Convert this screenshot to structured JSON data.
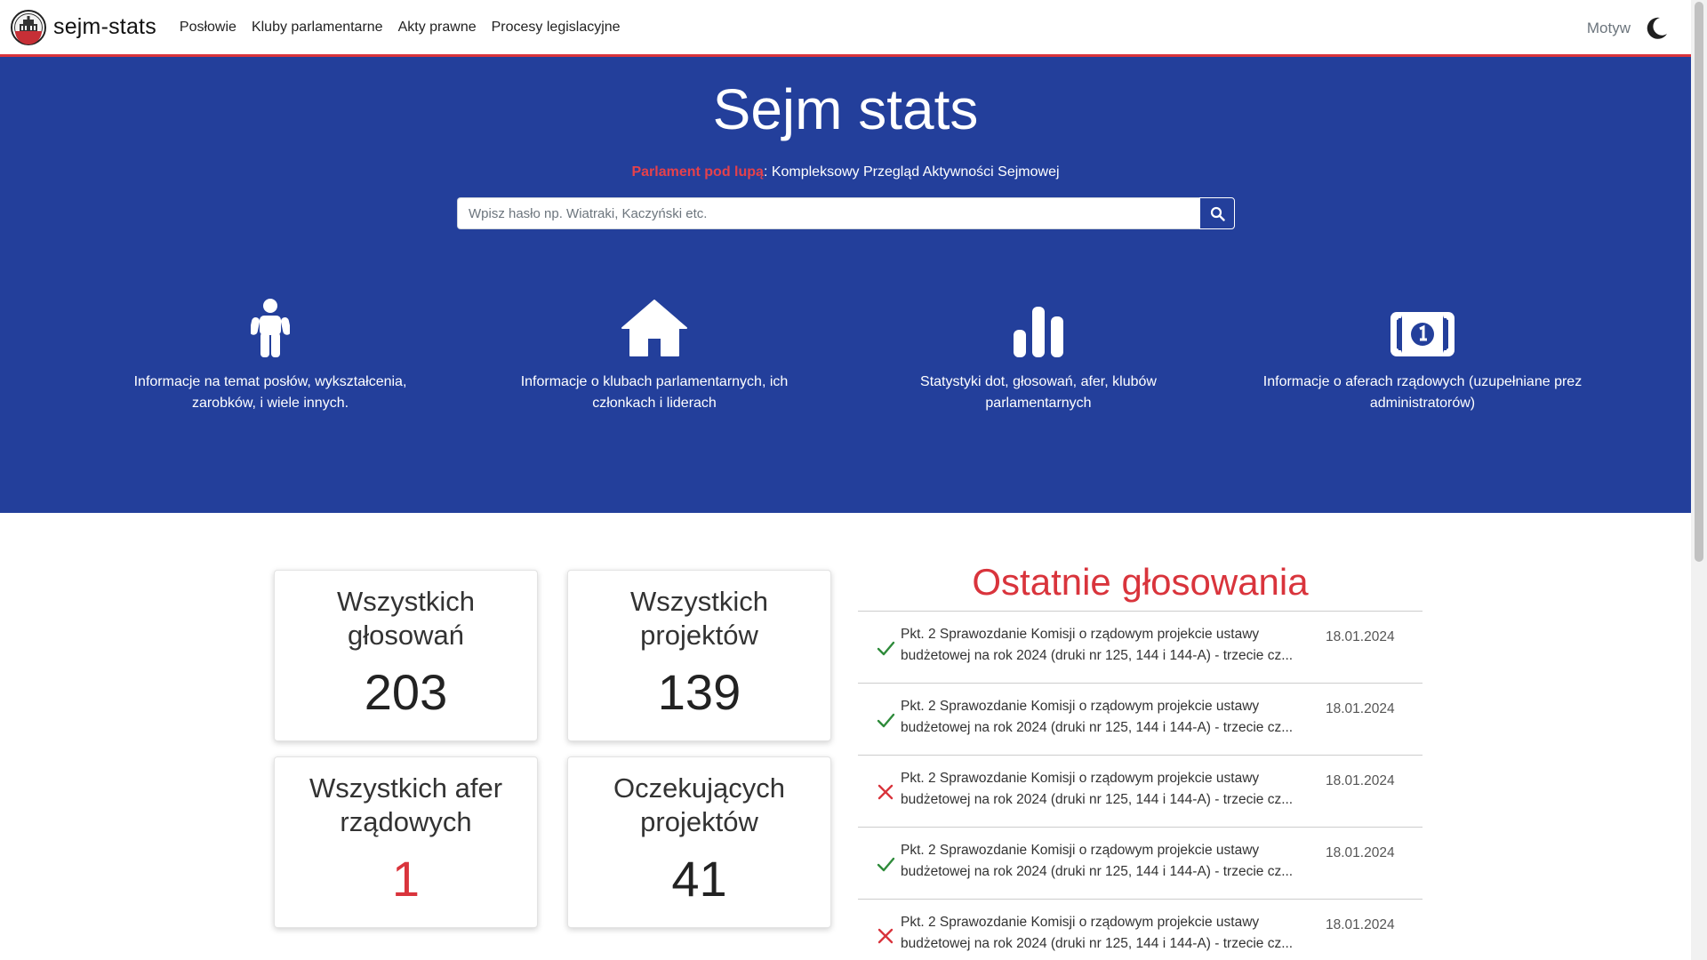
{
  "navbar": {
    "brand": "sejm-stats",
    "links": [
      "Posłowie",
      "Kluby parlamentarne",
      "Akty prawne",
      "Procesy legislacyjne"
    ],
    "theme_label": "Motyw"
  },
  "hero": {
    "title": "Sejm stats",
    "subtitle_highlight": "Parlament pod lupą",
    "subtitle_rest": ": Kompleksowy Przegląd Aktywności Sejmowej",
    "search_placeholder": "Wpisz hasło np. Wiatraki, Kaczyński etc."
  },
  "features": [
    {
      "icon": "person-icon",
      "text": "Informacje na temat posłów, wykształcenia, zarobków, i wiele innych."
    },
    {
      "icon": "house-icon",
      "text": "Informacje o klubach parlamentarnych, ich członkach i liderach"
    },
    {
      "icon": "bar-chart-icon",
      "text": "Statystyki dot, głosowań, afer, klubów parlamentarnych"
    },
    {
      "icon": "money-bill-icon",
      "text": "Informacje o aferach rządowych (uzupełniane prez administratorów)"
    }
  ],
  "stats": [
    {
      "label": "Wszystkich głosowań",
      "value": "203"
    },
    {
      "label": "Wszystkich projektów",
      "value": "139"
    },
    {
      "label": "Wszystkich afer rządowych",
      "value": "1"
    },
    {
      "label": "Oczekujących projektów",
      "value": "41"
    }
  ],
  "votes": {
    "title": "Ostatnie głosowania",
    "items": [
      {
        "status": "passed",
        "text": "Pkt. 2 Sprawozdanie Komisji o rządowym projekcie ustawy budżetowej na rok 2024 (druki nr 125, 144 i 144-A) - trzecie cz...",
        "date": "18.01.2024"
      },
      {
        "status": "passed",
        "text": "Pkt. 2 Sprawozdanie Komisji o rządowym projekcie ustawy budżetowej na rok 2024 (druki nr 125, 144 i 144-A) - trzecie cz...",
        "date": "18.01.2024"
      },
      {
        "status": "rejected",
        "text": "Pkt. 2 Sprawozdanie Komisji o rządowym projekcie ustawy budżetowej na rok 2024 (druki nr 125, 144 i 144-A) - trzecie cz...",
        "date": "18.01.2024"
      },
      {
        "status": "passed",
        "text": "Pkt. 2 Sprawozdanie Komisji o rządowym projekcie ustawy budżetowej na rok 2024 (druki nr 125, 144 i 144-A) - trzecie cz...",
        "date": "18.01.2024"
      },
      {
        "status": "rejected",
        "text": "Pkt. 2 Sprawozdanie Komisji o rządowym projekcie ustawy budżetowej na rok 2024 (druki nr 125, 144 i 144-A) - trzecie cz...",
        "date": "18.01.2024"
      }
    ]
  },
  "colors": {
    "hero_bg": "#233f9b",
    "accent_red": "#d9343c",
    "check_green": "#2e8b3a"
  }
}
